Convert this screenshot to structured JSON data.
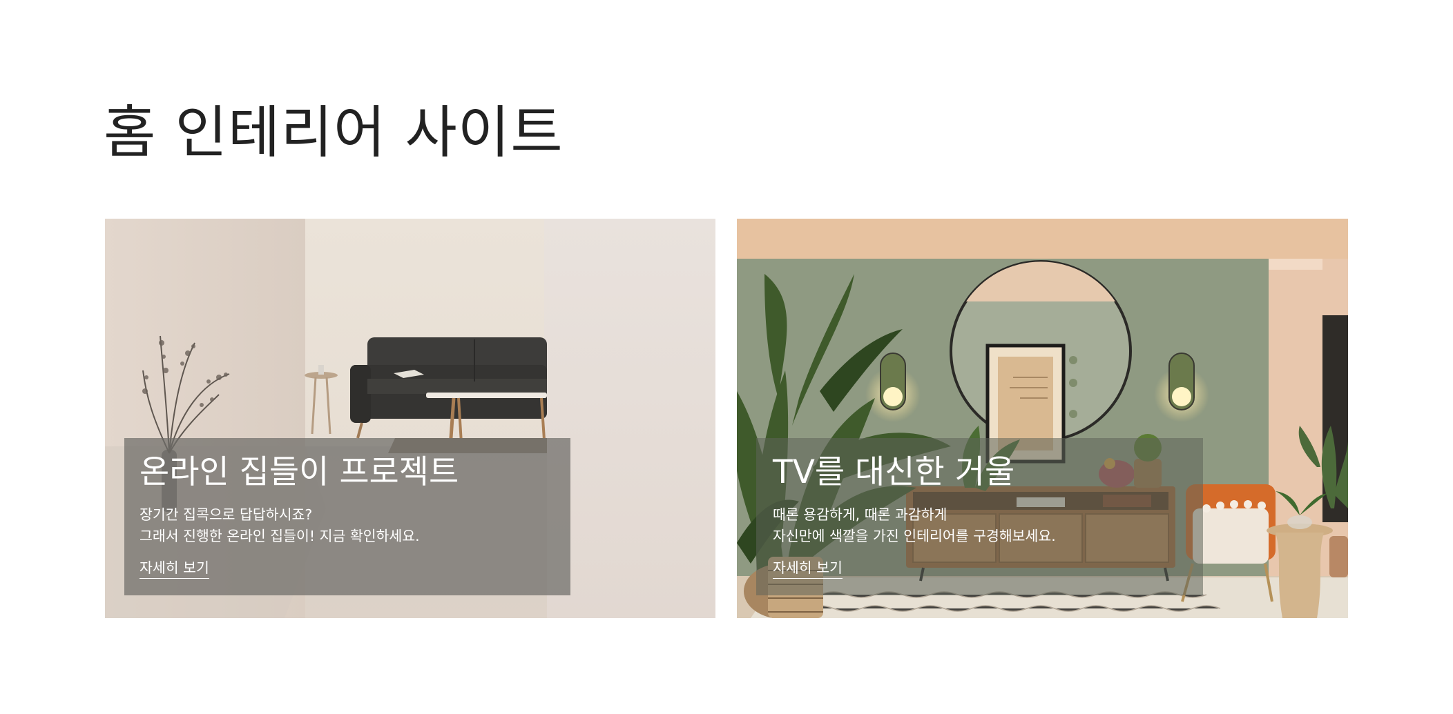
{
  "page": {
    "title": "홈 인테리어 사이트"
  },
  "cards": [
    {
      "title": "온라인 집들이 프로젝트",
      "desc_line1": "장기간 집콕으로 답답하시죠?",
      "desc_line2": "그래서 진행한 온라인 집들이! 지금 확인하세요.",
      "link": "자세히 보기",
      "image": "living-room-sofa-photo"
    },
    {
      "title": "TV를 대신한 거울",
      "desc_line1": "때론 용감하게, 때론 과감하게",
      "desc_line2": "자신만에 색깔을 가진 인테리어를 구경해보세요.",
      "link": "자세히 보기",
      "image": "living-room-mirror-photo"
    }
  ],
  "colors": {
    "title": "#222222",
    "overlay_text": "#ffffff"
  }
}
